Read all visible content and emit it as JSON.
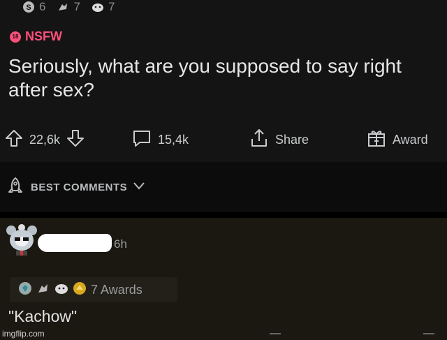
{
  "post": {
    "award_counts": [
      "6",
      "7",
      "7"
    ],
    "nsfw_label": "NSFW",
    "nsfw_badge": "18",
    "title": "Seriously, what are you supposed to say right after sex?",
    "upvotes": "22,6k",
    "comments": "15,4k",
    "share_label": "Share",
    "award_label": "Award"
  },
  "sort": {
    "label": "BEST COMMENTS"
  },
  "comment": {
    "time": "6h",
    "awards_label": "7 Awards",
    "text": "\"Kachow\""
  },
  "watermark": "imgflip.com",
  "colors": {
    "accent_nsfw": "#ff4f7b",
    "post_bg": "#141414",
    "comment_bg": "#1a1810"
  }
}
